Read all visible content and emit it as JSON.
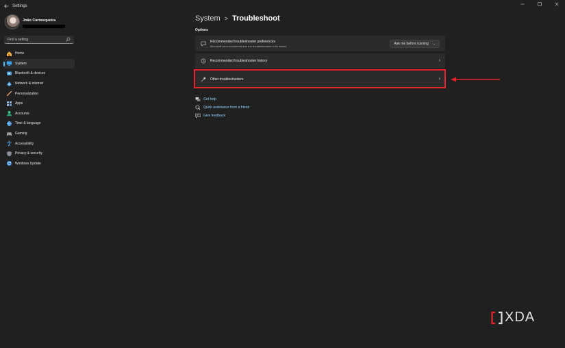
{
  "window": {
    "title": "Settings",
    "controls": [
      "minimize",
      "maximize",
      "close"
    ]
  },
  "profile": {
    "name": "João Carrasqueira"
  },
  "search": {
    "placeholder": "Find a setting"
  },
  "sidebar": {
    "items": [
      {
        "label": "Home",
        "icon": "home-icon",
        "active": false
      },
      {
        "label": "System",
        "icon": "system-icon",
        "active": true
      },
      {
        "label": "Bluetooth & devices",
        "icon": "bluetooth-icon",
        "active": false
      },
      {
        "label": "Network & internet",
        "icon": "network-icon",
        "active": false
      },
      {
        "label": "Personalization",
        "icon": "brush-icon",
        "active": false
      },
      {
        "label": "Apps",
        "icon": "apps-icon",
        "active": false
      },
      {
        "label": "Accounts",
        "icon": "accounts-icon",
        "active": false
      },
      {
        "label": "Time & language",
        "icon": "globe-icon",
        "active": false
      },
      {
        "label": "Gaming",
        "icon": "gamepad-icon",
        "active": false
      },
      {
        "label": "Accessibility",
        "icon": "accessibility-icon",
        "active": false
      },
      {
        "label": "Privacy & security",
        "icon": "shield-icon",
        "active": false
      },
      {
        "label": "Windows Update",
        "icon": "update-icon",
        "active": false
      }
    ]
  },
  "header": {
    "parent": "System",
    "separator": ">",
    "current": "Troubleshoot"
  },
  "options_label": "Options",
  "cards": {
    "preferences": {
      "title": "Recommended troubleshooter preferences",
      "subtitle": "Microsoft can recommend and run troubleshooters to fix issues",
      "dropdown_value": "Ask me before running"
    },
    "history": {
      "title": "Recommended troubleshooter history"
    },
    "other": {
      "title": "Other troubleshooters"
    }
  },
  "help": {
    "links": [
      {
        "label": "Get help",
        "icon": "help-icon"
      },
      {
        "label": "Quick assistance from a friend",
        "icon": "quick-assist-icon"
      },
      {
        "label": "Give feedback",
        "icon": "feedback-icon"
      }
    ]
  },
  "watermark": {
    "text": "XDA"
  },
  "colors": {
    "background": "#202020",
    "card": "#2b2b2b",
    "accent": "#4cc2ff",
    "highlight": "#e8232c",
    "link": "#8fd3ff"
  }
}
